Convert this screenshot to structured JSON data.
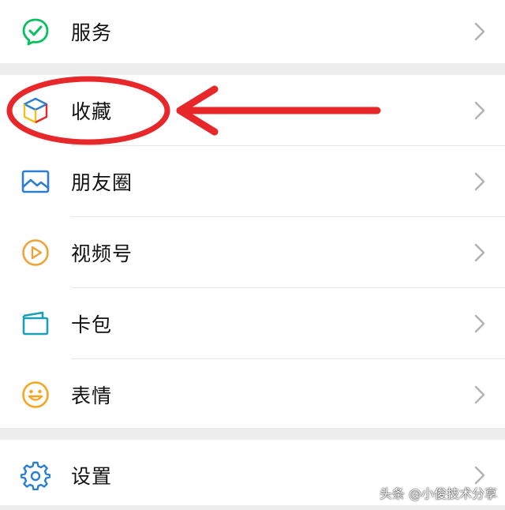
{
  "colors": {
    "background": "#ededed",
    "row_background": "#ffffff",
    "text": "#111111",
    "chevron": "#b2b2b2",
    "annotation_red": "#e8272b",
    "service_green": "#07c160",
    "moments_blue": "#2a7fd1",
    "channels_orange": "#f0a33b",
    "card_teal": "#1a9fb8",
    "sticker_orange": "#f5a623",
    "settings_blue": "#2a7fd1"
  },
  "menu": {
    "items": [
      {
        "label": "服务",
        "icon": "wechat-pay-service-icon"
      },
      {
        "label": "收藏",
        "icon": "favorites-cube-icon"
      },
      {
        "label": "朋友圈",
        "icon": "moments-picture-icon"
      },
      {
        "label": "视频号",
        "icon": "channels-play-icon"
      },
      {
        "label": "卡包",
        "icon": "card-wallet-icon"
      },
      {
        "label": "表情",
        "icon": "sticker-smiley-icon"
      },
      {
        "label": "设置",
        "icon": "settings-gear-icon"
      }
    ]
  },
  "watermark": {
    "text": "头条 @小俊技术分享"
  }
}
